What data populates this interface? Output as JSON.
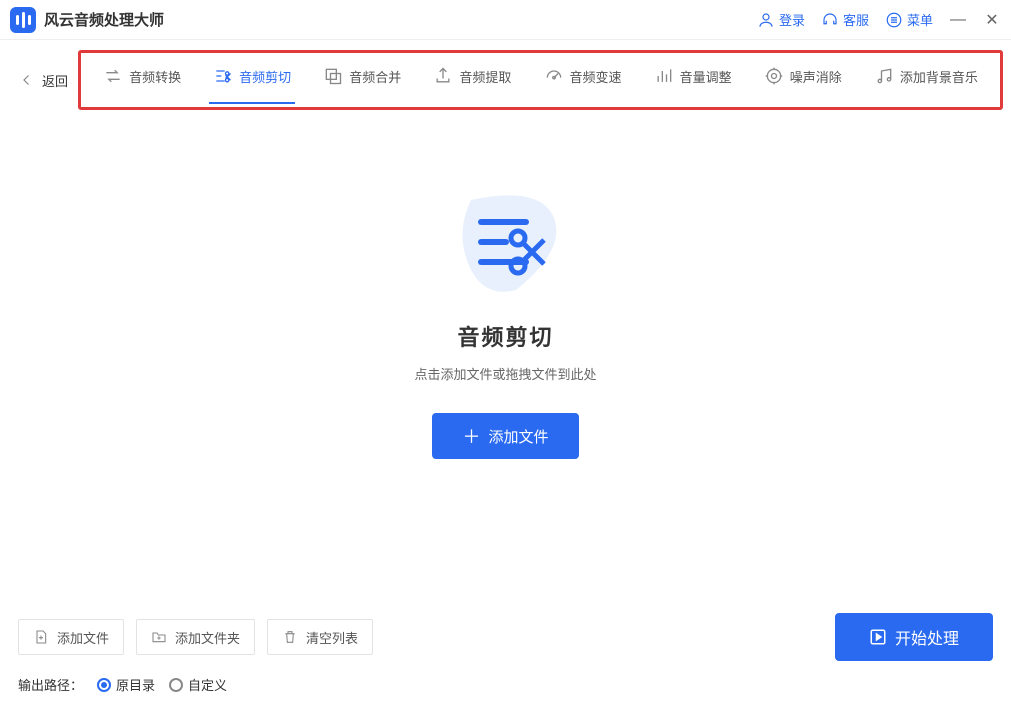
{
  "app": {
    "title": "风云音频处理大师"
  },
  "titlebar": {
    "login": "登录",
    "support": "客服",
    "menu": "菜单"
  },
  "back": "返回",
  "tools": [
    {
      "id": "convert",
      "label": "音频转换",
      "active": false
    },
    {
      "id": "cut",
      "label": "音频剪切",
      "active": true
    },
    {
      "id": "merge",
      "label": "音频合并",
      "active": false
    },
    {
      "id": "extract",
      "label": "音频提取",
      "active": false
    },
    {
      "id": "speed",
      "label": "音频变速",
      "active": false
    },
    {
      "id": "volume",
      "label": "音量调整",
      "active": false
    },
    {
      "id": "denoise",
      "label": "噪声消除",
      "active": false
    },
    {
      "id": "bgmusic",
      "label": "添加背景音乐",
      "active": false
    }
  ],
  "main": {
    "heading": "音频剪切",
    "sub": "点击添加文件或拖拽文件到此处",
    "add": "添加文件"
  },
  "bottom": {
    "add_file": "添加文件",
    "add_folder": "添加文件夹",
    "clear": "清空列表",
    "start": "开始处理",
    "output_label": "输出路径：",
    "radio_original": "原目录",
    "radio_custom": "自定义",
    "selected_output": "original"
  }
}
